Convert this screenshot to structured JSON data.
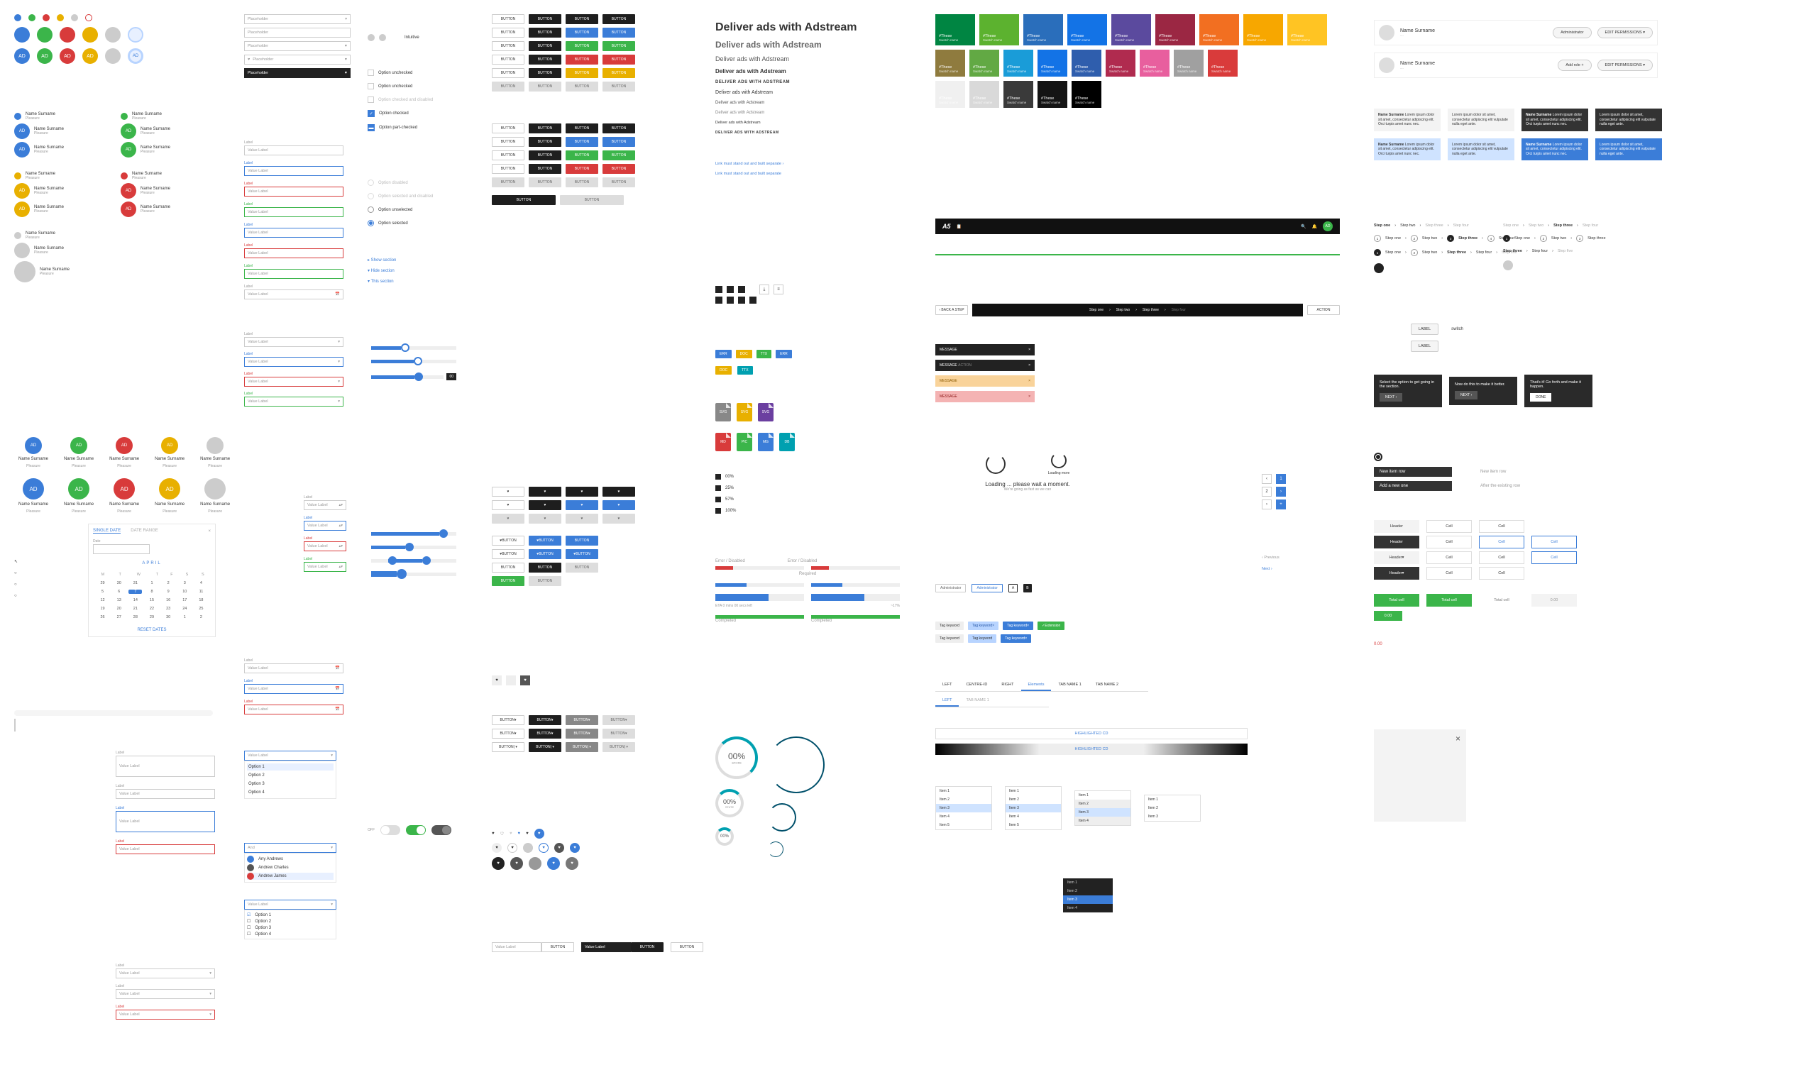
{
  "avatars": {
    "initials": "AD",
    "name": "Name Surname",
    "sub": "Pleasure"
  },
  "input": {
    "label": "Label",
    "value": "Value Label",
    "placeholder": "Placeholder"
  },
  "controls": {
    "toggle": "Intuitive",
    "check_unchecked": "Option unchecked",
    "check_checked": "Option checked",
    "check_indet": "Option part-checked",
    "radio_disabled": "Option disabled",
    "radio_unselect": "Option unselected",
    "radio_selected": "Option selected",
    "link_show": "▸ Show section",
    "link_hide": "▾ Hide section",
    "link_cta": "▾ This section"
  },
  "btn": "BUTTON",
  "typography": {
    "h1": "Deliver ads with Adstream",
    "h2": "Deliver ads with Adstream",
    "h3": "Deliver ads with Adstream",
    "h4": "Deliver ads with Adstream",
    "h5": "DELIVER ADS WITH ADSTREAM",
    "h6": "Deliver ads with Adstream",
    "h7": "Deliver ads with Adstream",
    "h8": "Deliver ads with Adstream",
    "h9": "Deliver ads with Adstream",
    "h10": "DELIVER ADS WITH ADSTREAM",
    "link1": "Link must stand out and built separate  ›",
    "link2": "Link must stand out and built separate"
  },
  "palette": {
    "primary": [
      "#008542",
      "#5cb22f",
      "#2a6ebb",
      "#1373e6",
      "#5b4a9e",
      "#9b2743",
      "#f26f21",
      "#f7a700",
      "#ffc423"
    ],
    "secondary": [
      "#8f7b3e",
      "#62a944",
      "#1a9cd8",
      "#1373e6",
      "#2f5ead",
      "#b02b4f",
      "#e85f9e",
      "#a0a0a0",
      "#d93b3b"
    ],
    "grays": [
      "#f0f0f0",
      "#d9d9d9",
      "#3a3a3a",
      "#141414",
      "#000000"
    ],
    "swatch_label": "#These",
    "swatch_sub": "Swatch name"
  },
  "chips": {
    "err": "ERR",
    "doc": "DOC",
    "ttx": "TTX",
    "svg": "SVG",
    "md": "MD",
    "pic": "PIC",
    "mg": "MG",
    "db": "DB"
  },
  "percent": {
    "p0": "00%",
    "p25": "25%",
    "p57": "57%",
    "p100": "100%"
  },
  "error": {
    "title": "Error / Disabled",
    "sub": "Required",
    "label": "Completed",
    "eta": "ETA 0 mins 00 secs left",
    "pct17": "~17%"
  },
  "donut": {
    "val": "00%",
    "sub": "STATE"
  },
  "nav": {
    "brand": "A5",
    "search": "",
    "back": "‹ BACK A STEP",
    "steps": [
      "Step one",
      "Step two",
      "Step three",
      "Step four"
    ],
    "action": "ACTION"
  },
  "loading": {
    "main": "Loading ... please wait a moment.",
    "sub": "We're going as fast as we can",
    "more": "Loading more"
  },
  "admin": {
    "tag1": "Administrator",
    "tag2": "Administrator",
    "a": "A",
    "b": "B"
  },
  "tags": {
    "keyword": "Tag keyword",
    "ext": "Extension"
  },
  "tabs": {
    "left": "LEFT",
    "center": "CENTRE-ID",
    "right": "RIGHT",
    "elements": "Elements",
    "tabname1": "TAB NAME 1",
    "tabname2": "TAB NAME 2"
  },
  "msg": {
    "message": "MESSAGE",
    "action": "ACTION"
  },
  "pager": {
    "prev": "‹ Previous",
    "next": "Next ›"
  },
  "perms": {
    "name": "Name Surname",
    "sub": "…",
    "btn_admin": "Administrator",
    "btn_role": "Add role +",
    "btn_edit": "EDIT PERMISSIONS  ▾"
  },
  "notes": {
    "name_em": "Name Surname",
    "lorem1": "Lorem ipsum dolor sit amet, consectetur adipiscing elit. Orci turpis amet nunc nec.",
    "lorem2": "Lorem ipsum dolor sit amet, consectetur adipiscing elit vulputate nulla eget ante."
  },
  "steps": {
    "s1": "Step one",
    "s2": "Step two",
    "s3": "Step three",
    "s4": "Step four",
    "s5": "Step five"
  },
  "switch": {
    "lbl": "switch"
  },
  "tips": {
    "t1": "Select the option to get going in the section.",
    "t2": "Now do this to make it better.",
    "t3": "That's it! Go forth and make it happen.",
    "next": "NEXT  ›",
    "done": "DONE"
  },
  "tbl": {
    "header": "Header",
    "cell": "Cell",
    "total": "Total cell",
    "val": "0.00"
  },
  "inline": {
    "high": "HIGHLIGHTED CD"
  },
  "list": {
    "item": "Item"
  },
  "datepicker": {
    "single": "SINGLE DATE",
    "range": "DATE RANGE",
    "label": "Date",
    "month": "APRIL",
    "reset": "RESET DATES",
    "days": [
      "M",
      "T",
      "W",
      "T",
      "F",
      "S",
      "S"
    ],
    "rows": [
      [
        "29",
        "30",
        "31",
        "1",
        "2",
        "3",
        "4"
      ],
      [
        "5",
        "6",
        "7",
        "8",
        "9",
        "10",
        "11"
      ],
      [
        "12",
        "13",
        "14",
        "15",
        "16",
        "17",
        "18"
      ],
      [
        "19",
        "20",
        "21",
        "22",
        "23",
        "24",
        "25"
      ],
      [
        "26",
        "27",
        "28",
        "29",
        "30",
        "1",
        "2"
      ]
    ]
  },
  "dropdown": {
    "options": [
      "Option 1",
      "Option 2",
      "Option 3",
      "Option 4"
    ],
    "people": [
      "Any Andrews",
      "Andrew Charles",
      "Andrew James"
    ]
  },
  "combo": {
    "val": "Value Label",
    "btn": "BUTTON"
  }
}
